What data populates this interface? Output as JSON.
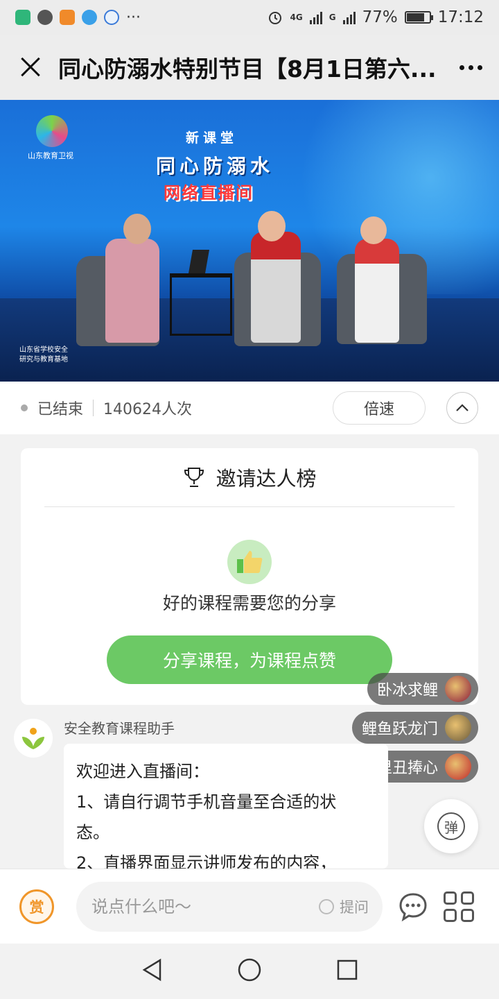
{
  "status_bar": {
    "app_icons": [
      "shield-app-icon",
      "wechat-icon",
      "video-app-icon",
      "browser-app-icon",
      "paw-app-icon"
    ],
    "more": "···",
    "network1": "4G",
    "network2": "G",
    "battery_text": "77%",
    "battery_level": 0.77,
    "time": "17:12"
  },
  "header": {
    "title": "同心防溺水特别节目【8月1日第六..."
  },
  "video": {
    "channel": "山东教育卫视",
    "line1": "新课堂",
    "line2": "同心防溺水",
    "line3": "网络直播间",
    "watermark": [
      "山东省学校安全",
      "研究与教育基地"
    ]
  },
  "info": {
    "status": "已结束",
    "views": "140624人次",
    "speed_label": "倍速"
  },
  "invite_card": {
    "title": "邀请达人榜",
    "subtitle": "好的课程需要您的分享",
    "button": "分享课程，为课程点赞"
  },
  "danmaku": [
    {
      "name": "卧冰求鲤",
      "color": "#8a1a3a"
    },
    {
      "name": "鲤鱼跃龙门",
      "color": "#6a5a3a"
    },
    {
      "name": "里丑捧心",
      "color": "#c0282a"
    }
  ],
  "chat": {
    "assistant_name": "安全教育课程助手",
    "message_lines": [
      "欢迎进入直播间：",
      "1、请自行调节手机音量至合适的状",
      "态。",
      "2、直播界面显示讲师发布的内容，"
    ],
    "danmu_toggle": "弹"
  },
  "input_bar": {
    "reward_label": "赏",
    "placeholder": "说点什么吧〜",
    "ask_label": "提问"
  },
  "colors": {
    "accent_green": "#6cc965",
    "reward_orange": "#f0962a"
  }
}
